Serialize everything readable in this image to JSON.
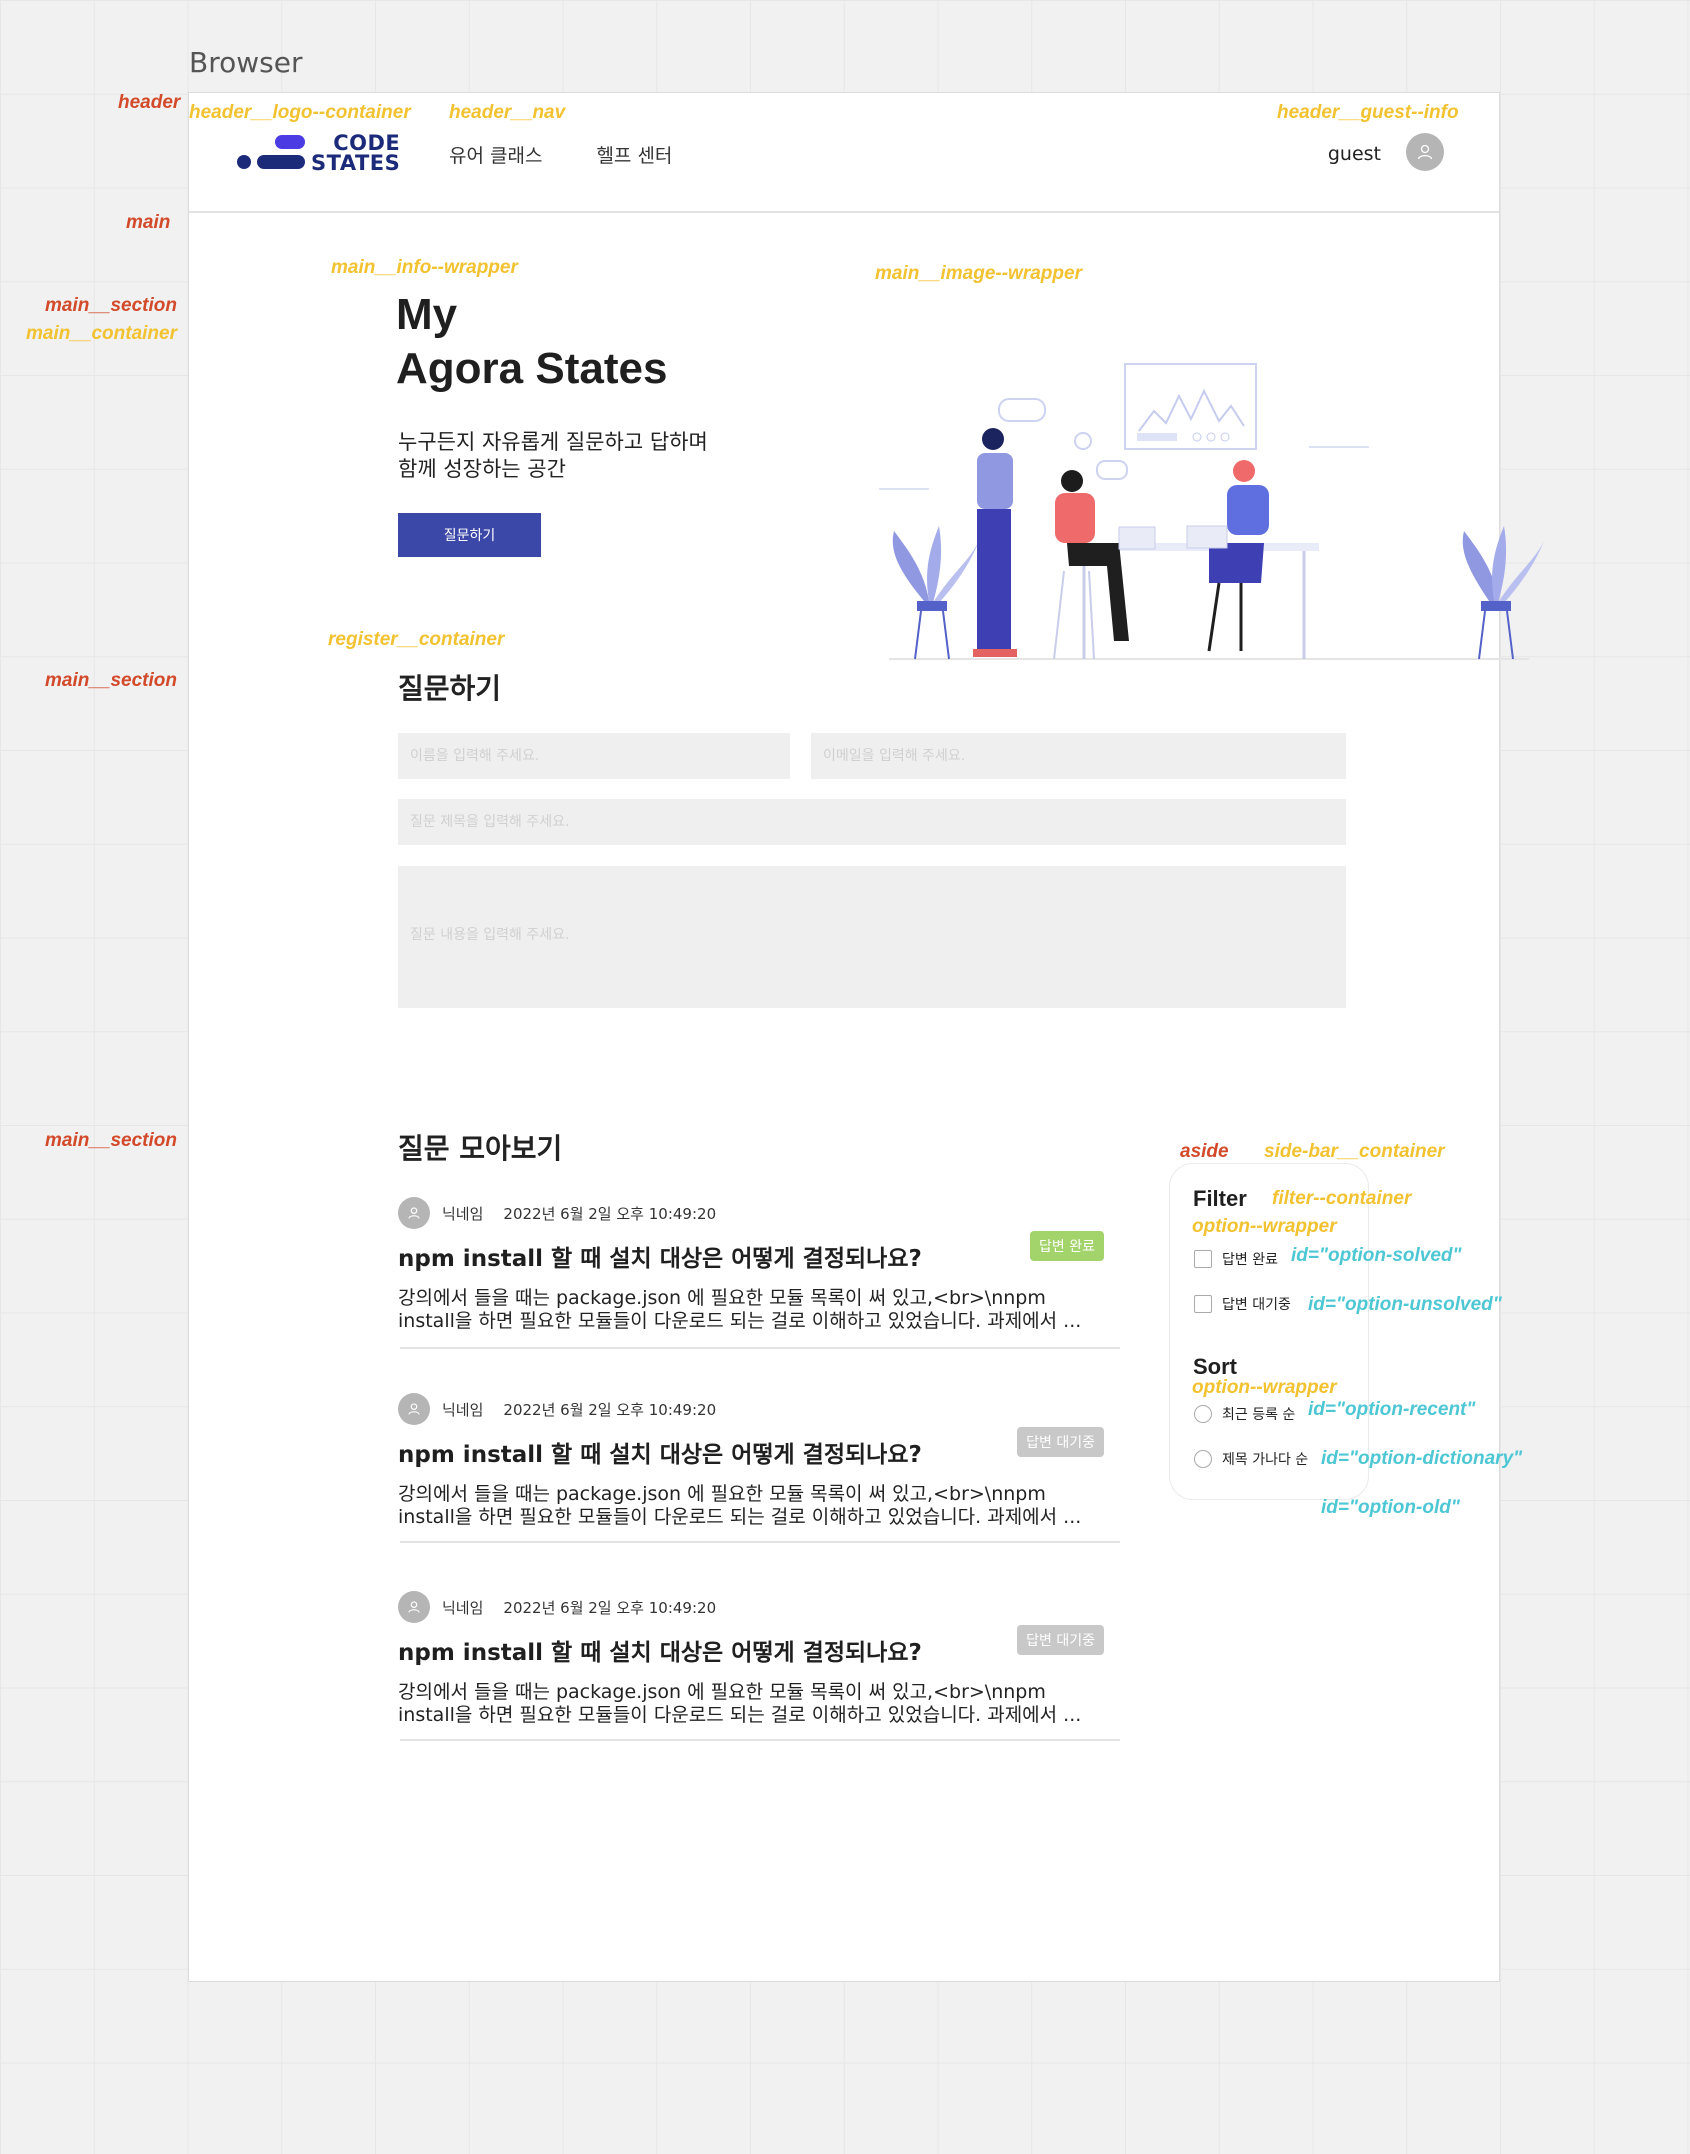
{
  "browser_label": "Browser",
  "annotations": {
    "header": "header",
    "header_logo_container": "header__logo--container",
    "header_nav": "header__nav",
    "header_guest_info": "header__guest--info",
    "main": "main",
    "main_section_1": "main__section",
    "main_container": "main__container",
    "main_info_wrapper": "main__info--wrapper",
    "main_image_wrapper": "main__image--wrapper",
    "register_container": "register__container",
    "main_section_2": "main__section",
    "main_section_3": "main__section",
    "aside": "aside",
    "side_bar_container": "side-bar__container",
    "filter_container": "filter--container",
    "option_wrapper_1": "option--wrapper",
    "option_wrapper_2": "option--wrapper",
    "id_option_solved": "id=\"option-solved\"",
    "id_option_unsolved": "id=\"option-unsolved\"",
    "id_option_recent": "id=\"option-recent\"",
    "id_option_dictionary": "id=\"option-dictionary\"",
    "id_option_old": "id=\"option-old\""
  },
  "header": {
    "logo_line1": "CODE",
    "logo_line2": "STATES",
    "nav": [
      "유어 클래스",
      "헬프 센터"
    ],
    "guest": "guest"
  },
  "hero": {
    "title_line1": "My",
    "title_line2": "Agora States",
    "subtitle_line1": "누구든지 자유롭게 질문하고 답하며",
    "subtitle_line2": "함께 성장하는 공간",
    "button": "질문하기"
  },
  "register": {
    "title": "질문하기",
    "name_placeholder": "이름을 입력해 주세요.",
    "email_placeholder": "이메일을 입력해 주세요.",
    "subject_placeholder": "질문 제목을 입력해 주세요.",
    "body_placeholder": "질문 내용을 입력해 주세요."
  },
  "questions": {
    "title": "질문 모아보기",
    "items": [
      {
        "nickname": "닉네임",
        "date": "2022년 6월 2일 오후 10:49:20",
        "title": "npm install 할 때 설치 대상은 어떻게 결정되나요?",
        "body_line1": "강의에서 들을 때는 package.json 에 필요한 모듈 목록이 써 있고,<br>\\nnpm",
        "body_line2": "install을 하면 필요한 모듈들이 다운로드 되는 걸로 이해하고 있었습니다. 과제에서 ...",
        "badge": "답변 완료",
        "badge_color": "#a3d36b"
      },
      {
        "nickname": "닉네임",
        "date": "2022년 6월 2일 오후 10:49:20",
        "title": "npm install 할 때 설치 대상은 어떻게 결정되나요?",
        "body_line1": "강의에서 들을 때는 package.json 에 필요한 모듈 목록이 써 있고,<br>\\nnpm",
        "body_line2": "install을 하면 필요한 모듈들이 다운로드 되는 걸로 이해하고 있었습니다. 과제에서 ...",
        "badge": "답변 대기중",
        "badge_color": "#c8c8c8"
      },
      {
        "nickname": "닉네임",
        "date": "2022년 6월 2일 오후 10:49:20",
        "title": "npm install 할 때 설치 대상은 어떻게 결정되나요?",
        "body_line1": "강의에서 들을 때는 package.json 에 필요한 모듈 목록이 써 있고,<br>\\nnpm",
        "body_line2": "install을 하면 필요한 모듈들이 다운로드 되는 걸로 이해하고 있었습니다. 과제에서 ...",
        "badge": "답변 대기중",
        "badge_color": "#c8c8c8"
      }
    ]
  },
  "sidebar": {
    "filter_title": "Filter",
    "filter_options": [
      "답변 완료",
      "답변 대기중"
    ],
    "sort_title": "Sort",
    "sort_options": [
      "최근 등록 순",
      "제목 가나다 순"
    ]
  },
  "colors": {
    "primary_button": "#3c48a8",
    "annotation_red": "#d24a2a",
    "annotation_yellow": "#f2c230",
    "annotation_cyan": "#4ec7d4"
  }
}
